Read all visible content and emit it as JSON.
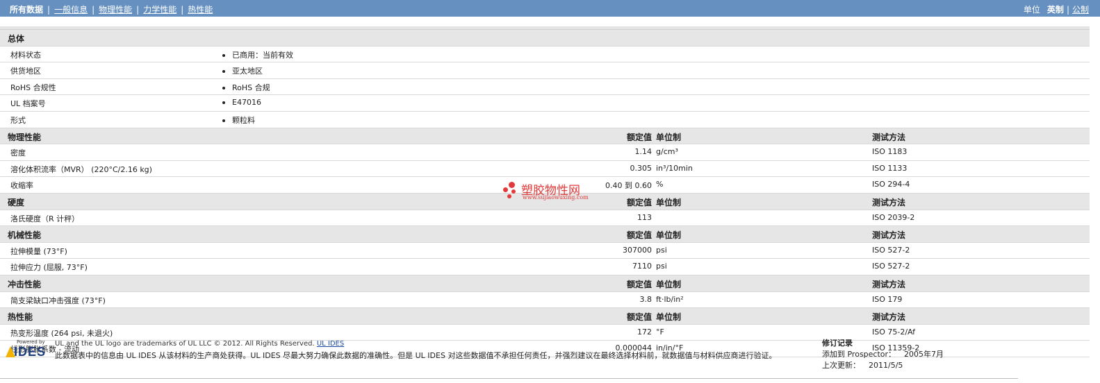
{
  "nav": {
    "current": "所有数据",
    "links": [
      "一般信息",
      "物理性能",
      "力学性能",
      "热性能"
    ]
  },
  "units": {
    "label": "单位",
    "current": "英制",
    "other": "公制"
  },
  "general": {
    "title": "总体",
    "rows": [
      {
        "name": "材料状态",
        "value": "已商用：当前有效"
      },
      {
        "name": "供货地区",
        "value": "亚太地区"
      },
      {
        "name": "RoHS 合规性",
        "value": "RoHS 合规"
      },
      {
        "name": "UL 档案号",
        "value": "E47016"
      },
      {
        "name": "形式",
        "value": "颗粒料"
      }
    ]
  },
  "col_headers": {
    "nominal": "额定值",
    "unit": "单位制",
    "method": "测试方法"
  },
  "sections": [
    {
      "title": "物理性能",
      "rows": [
        {
          "name": "密度",
          "nominal": "1.14",
          "unit": "g/cm³",
          "method": "ISO 1183"
        },
        {
          "name": "溶化体积流率（MVR） (220°C/2.16 kg)",
          "nominal": "0.305",
          "unit": "in³/10min",
          "method": "ISO 1133"
        },
        {
          "name": "收缩率",
          "nominal": "0.40 到  0.60",
          "unit": "%",
          "method": "ISO 294-4"
        }
      ]
    },
    {
      "title": "硬度",
      "rows": [
        {
          "name": "洛氏硬度（R 计秤）",
          "nominal": "113",
          "unit": "",
          "method": "ISO 2039-2"
        }
      ]
    },
    {
      "title": "机械性能",
      "rows": [
        {
          "name": "拉伸模量 (73°F)",
          "nominal": "307000",
          "unit": "psi",
          "method": "ISO 527-2"
        },
        {
          "name": "拉伸应力 (屈服, 73°F)",
          "nominal": "7110",
          "unit": "psi",
          "method": "ISO 527-2"
        }
      ]
    },
    {
      "title": "冲击性能",
      "rows": [
        {
          "name": "简支梁缺口冲击强度 (73°F)",
          "nominal": "3.8",
          "unit": "ft·lb/in²",
          "method": "ISO 179"
        }
      ]
    },
    {
      "title": "热性能",
      "rows": [
        {
          "name": "热变形温度 (264 psi, 未退火)",
          "nominal": "172",
          "unit": "°F",
          "method": "ISO 75-2/Af"
        },
        {
          "name": "线形膨胀系数 - 流动",
          "nominal": "0.000044",
          "unit": "in/in/°F",
          "method": "ISO 11359-2"
        }
      ]
    }
  ],
  "watermark": {
    "text": "塑胶物性网",
    "url": "www.sujiaowuxing.com"
  },
  "footer": {
    "logo_small": "Powered by",
    "logo_main": "IDES",
    "trademark": "UL and the UL logo are trademarks of UL LLC © 2012. All Rights Reserved.",
    "trademark_link": "UL IDES",
    "disclaimer": "此数据表中的信息由 UL IDES 从该材料的生产商处获得。UL IDES 尽最大努力确保此数据的准确性。但是 UL IDES 对这些数据值不承担任何责任，并强烈建议在最终选择材料前，就数据值与材料供应商进行验证。",
    "revision": {
      "title": "修订记录",
      "added_label": "添加到 Prospector：",
      "added_value": "2005年7月",
      "updated_label": "上次更新：",
      "updated_value": "2011/5/5"
    }
  }
}
